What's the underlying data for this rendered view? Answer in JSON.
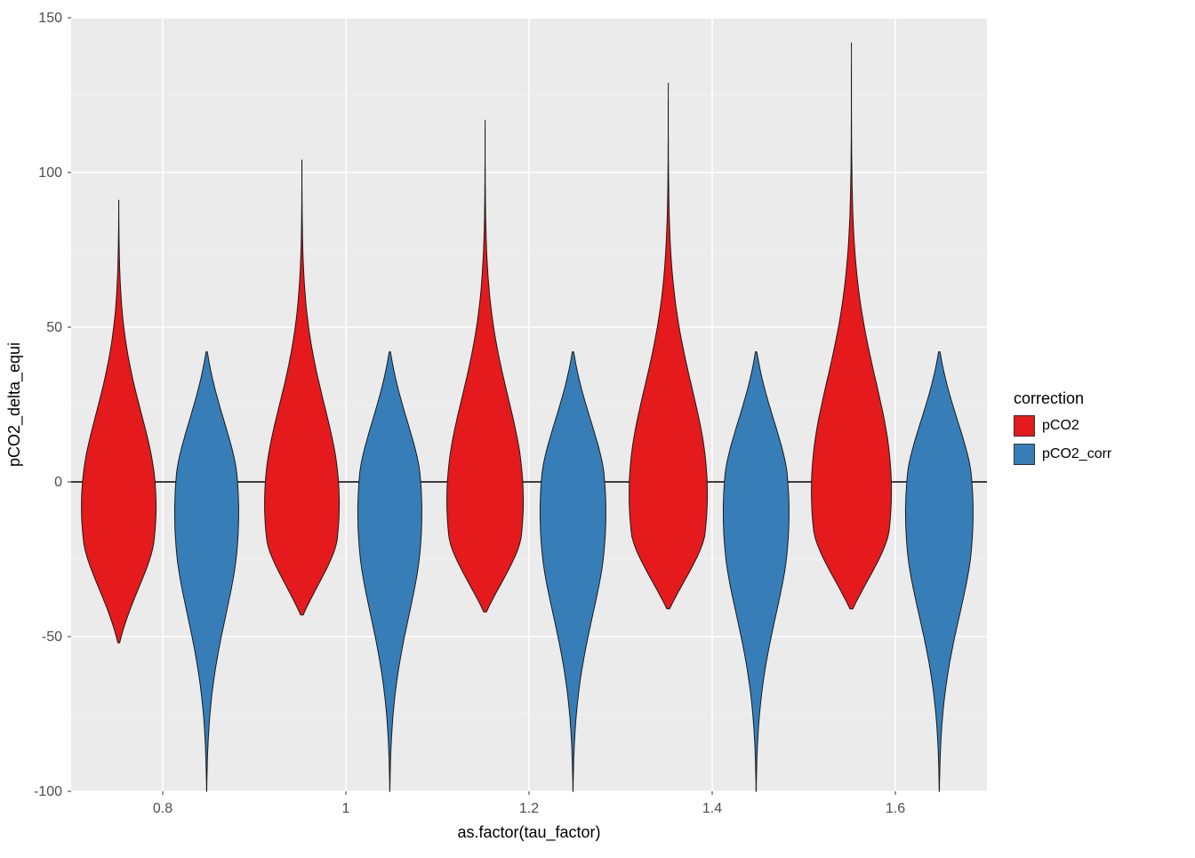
{
  "chart_data": {
    "type": "violin",
    "xlabel": "as.factor(tau_factor)",
    "ylabel": "pCO2_delta_equi",
    "ylim": [
      -100,
      150
    ],
    "y_ticks": [
      -100,
      -50,
      0,
      50,
      100,
      150
    ],
    "categories": [
      "0.8",
      "1",
      "1.2",
      "1.4",
      "1.6"
    ],
    "legend_title": "correction",
    "series": [
      {
        "name": "pCO2",
        "color": "#E41A1C",
        "violins": [
          {
            "median": -8,
            "q1": -20,
            "q3": 5,
            "min": -52,
            "max": 91,
            "max_width": 42,
            "tail_top": true
          },
          {
            "median": -7,
            "q1": -19,
            "q3": 7,
            "min": -43,
            "max": 104,
            "max_width": 42,
            "tail_top": true
          },
          {
            "median": -6,
            "q1": -18,
            "q3": 9,
            "min": -42,
            "max": 117,
            "max_width": 43,
            "tail_top": true
          },
          {
            "median": -4,
            "q1": -17,
            "q3": 11,
            "min": -41,
            "max": 129,
            "max_width": 44,
            "tail_top": true
          },
          {
            "median": -3,
            "q1": -16,
            "q3": 13,
            "min": -41,
            "max": 142,
            "max_width": 45,
            "tail_top": true
          }
        ]
      },
      {
        "name": "pCO2_corr",
        "color": "#377EB8",
        "violins": [
          {
            "median": -10,
            "q1": -25,
            "q3": 3,
            "min": -100,
            "max": 42,
            "max_width": 36,
            "tail_top": false
          },
          {
            "median": -10,
            "q1": -25,
            "q3": 3,
            "min": -100,
            "max": 42,
            "max_width": 36,
            "tail_top": false
          },
          {
            "median": -10,
            "q1": -25,
            "q3": 3,
            "min": -100,
            "max": 42,
            "max_width": 37,
            "tail_top": false
          },
          {
            "median": -10,
            "q1": -25,
            "q3": 3,
            "min": -100,
            "max": 42,
            "max_width": 37,
            "tail_top": false
          },
          {
            "median": -10,
            "q1": -25,
            "q3": 3,
            "min": -100,
            "max": 42,
            "max_width": 38,
            "tail_top": false
          }
        ]
      }
    ],
    "annotations": {
      "hline": 0
    }
  }
}
